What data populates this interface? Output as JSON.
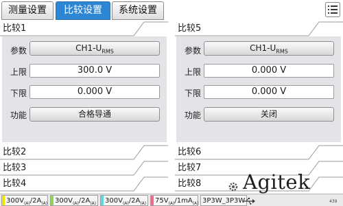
{
  "tabs": [
    {
      "label": "测量设置"
    },
    {
      "label": "比较设置"
    },
    {
      "label": "系统设置"
    }
  ],
  "compare": {
    "c1": {
      "title": "比较1",
      "param_label": "参数",
      "param_value": "CH1-U",
      "param_sub": "RMS",
      "upper_label": "上限",
      "upper_value": "300.0 V",
      "lower_label": "下限",
      "lower_value": "0.000 V",
      "func_label": "功能",
      "func_value": "合格导通"
    },
    "c5": {
      "title": "比较5",
      "param_label": "参数",
      "param_value": "CH1-U",
      "param_sub": "RMS",
      "upper_label": "上限",
      "upper_value": "0.000 V",
      "lower_label": "下限",
      "lower_value": "0.000 V",
      "func_label": "功能",
      "func_value": "关闭"
    },
    "collapsed_left": [
      "比较2",
      "比较3",
      "比较4"
    ],
    "collapsed_right": [
      "比较6",
      "比较7",
      "比较8"
    ]
  },
  "statusbar": {
    "channels": [
      {
        "v": "300V",
        "vs": "(A)",
        "a": "/2A",
        "as": "(A)",
        "color": "#f2e600"
      },
      {
        "v": "300V",
        "vs": "(A)",
        "a": "/2A",
        "as": "(A)",
        "color": "#8fd45a"
      },
      {
        "v": "300V",
        "vs": "(A)",
        "a": "/2A",
        "as": "(A)",
        "color": "#5fd6e6"
      },
      {
        "v": "75V",
        "vs": "(A)",
        "a": "/1mA",
        "as": "(A)",
        "color": "#f06a8c"
      }
    ],
    "wiring": "3P3W_3P3W"
  },
  "brand": {
    "logo": "Agitek",
    "small_text": "439"
  },
  "icons": {
    "menu": "menu-list-icon",
    "usb": "usb-icon",
    "gear": "gear-icon"
  }
}
